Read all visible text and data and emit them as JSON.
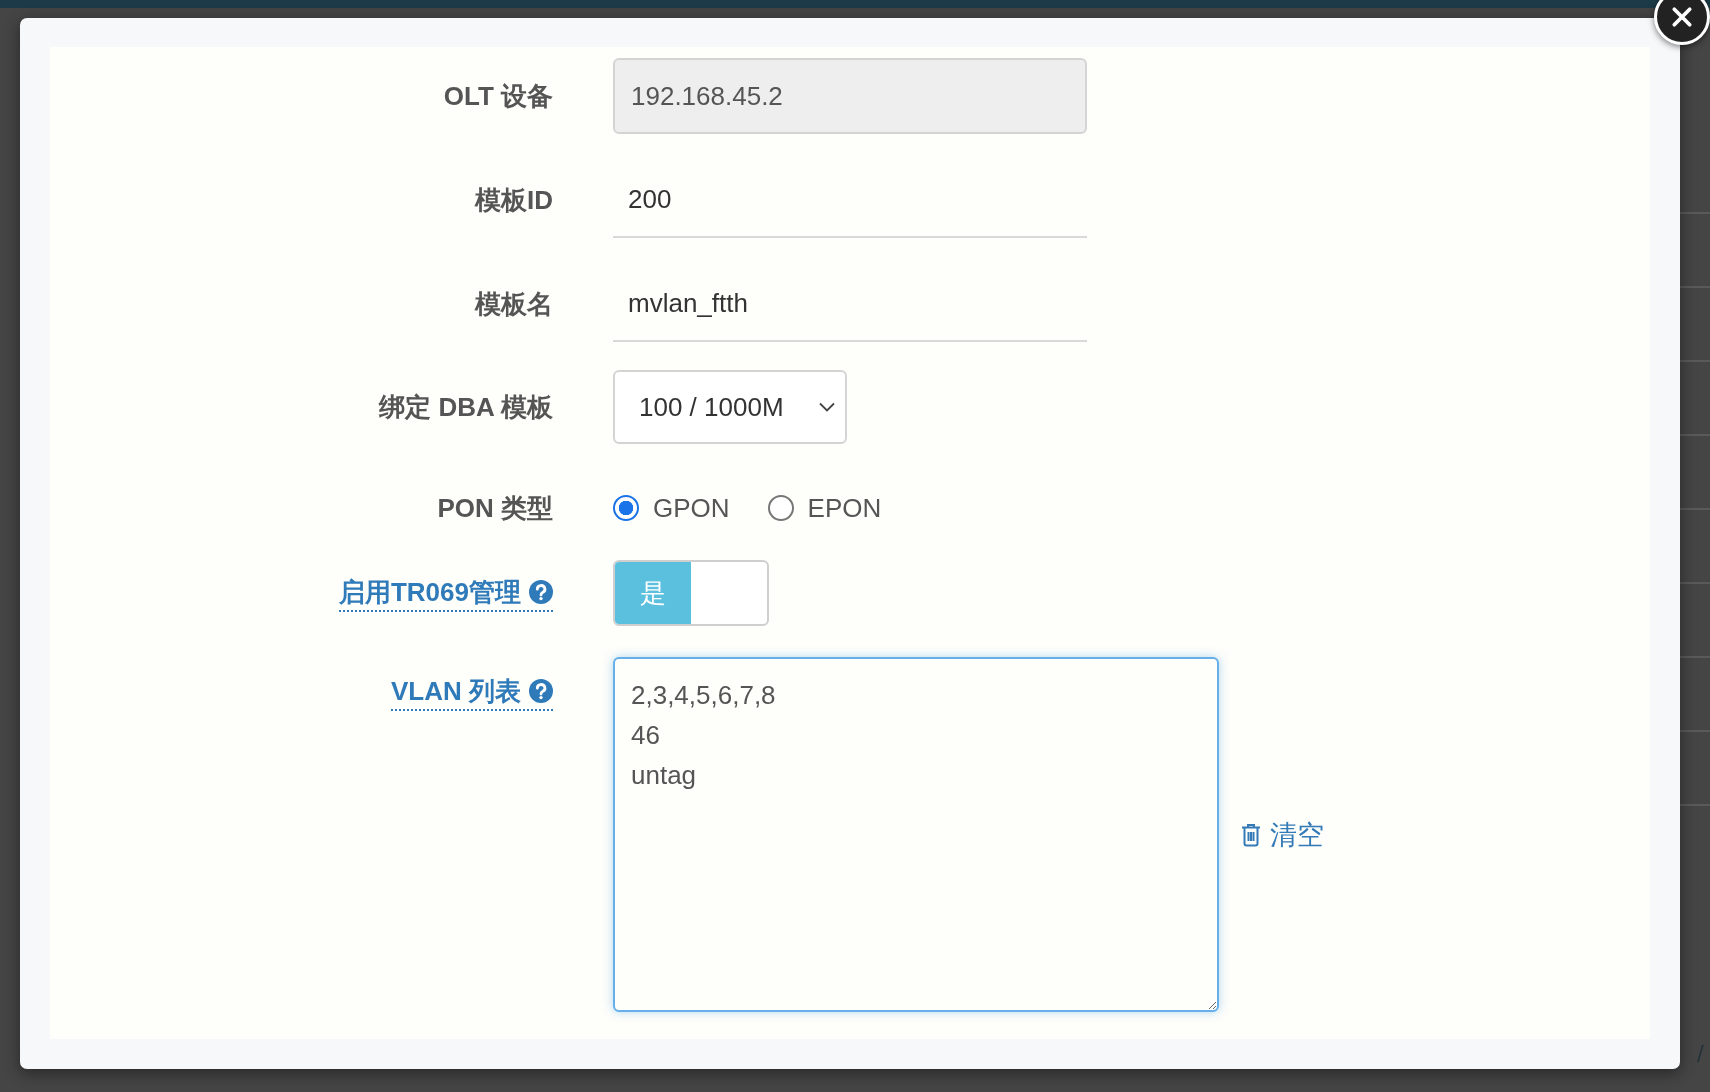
{
  "background": {
    "text_fragment": "/"
  },
  "form": {
    "fields": [
      {
        "kind": "readonly",
        "label": "OLT 设备",
        "help": false,
        "value": "192.168.45.2"
      },
      {
        "kind": "text",
        "label": "模板ID",
        "help": false,
        "value": "200"
      },
      {
        "kind": "text",
        "label": "模板名",
        "help": false,
        "value": "mvlan_ftth"
      },
      {
        "kind": "select",
        "label": "绑定 DBA 模板",
        "help": false,
        "value": "100 / 1000M"
      },
      {
        "kind": "radio",
        "label": "PON 类型",
        "help": false,
        "options": [
          {
            "label": "GPON",
            "selected": true
          },
          {
            "label": "EPON",
            "selected": false
          }
        ]
      },
      {
        "kind": "toggle",
        "label": "启用TR069管理",
        "help": true,
        "on": true,
        "on_label": "是"
      },
      {
        "kind": "textarea",
        "label": "VLAN 列表",
        "help": true,
        "value": "2,3,4,5,6,7,8\n46\nuntag",
        "action": "清空"
      }
    ]
  }
}
